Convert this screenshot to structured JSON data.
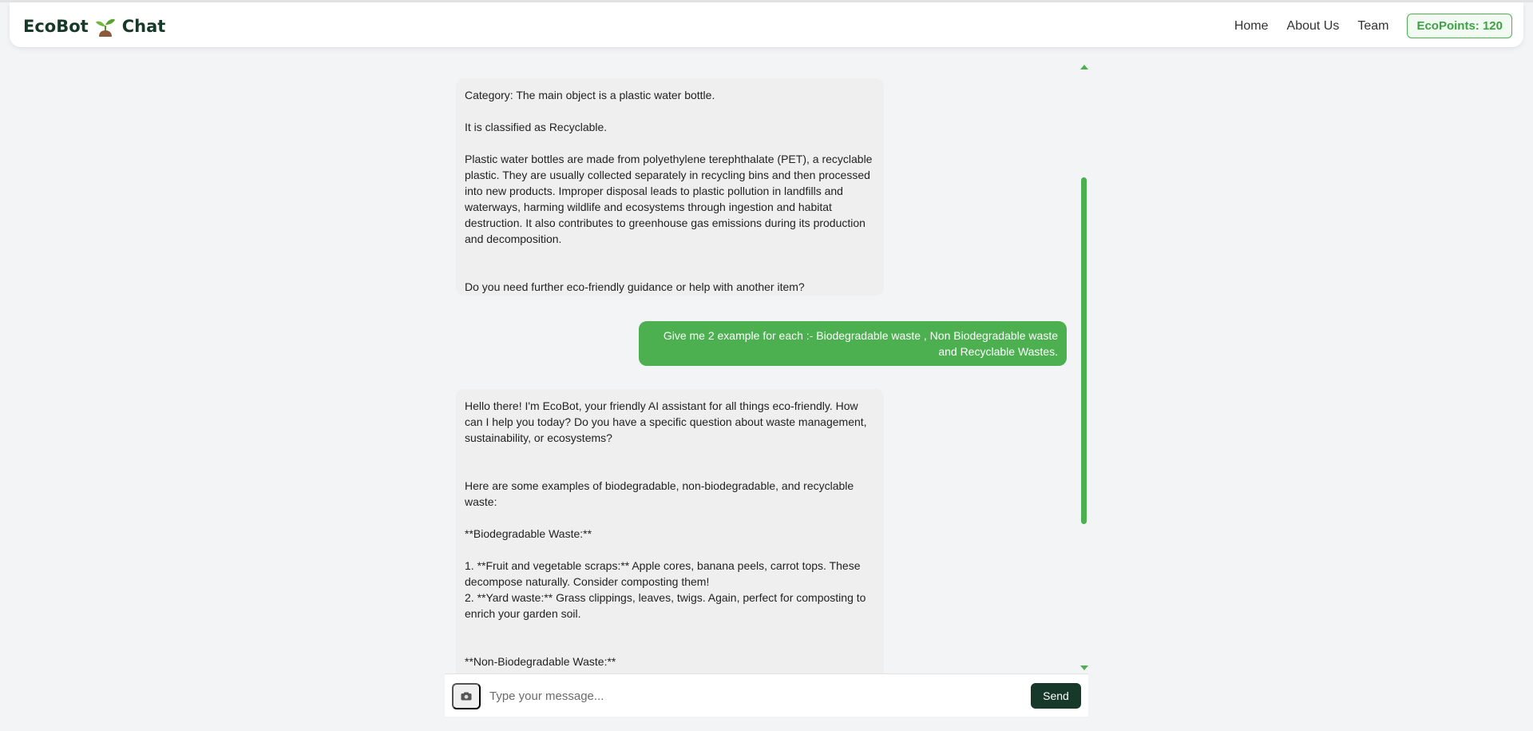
{
  "brand": {
    "left": "EcoBot",
    "right": "Chat",
    "icon": "sprout-icon"
  },
  "nav": {
    "home": "Home",
    "about": "About Us",
    "team": "Team",
    "ecopoints": "EcoPoints: 120"
  },
  "colors": {
    "accent": "#4caf50",
    "dark": "#16392a",
    "bubble": "#efefef"
  },
  "messages": [
    {
      "role": "bot",
      "text": "Category: The main object is a plastic water bottle.\n\nIt is classified as Recyclable.\n\nPlastic water bottles are made from polyethylene terephthalate (PET), a recyclable plastic. They are usually collected separately in recycling bins and then processed into new products. Improper disposal leads to plastic pollution in landfills and waterways, harming wildlife and ecosystems through ingestion and habitat destruction. It also contributes to greenhouse gas emissions during its production and decomposition.\n\n\nDo you need further eco-friendly guidance or help with another item?"
    },
    {
      "role": "user",
      "text": "Give me 2 example for each :- Biodegradable waste , Non Biodegradable waste and Recyclable Wastes."
    },
    {
      "role": "bot",
      "text": "Hello there! I'm EcoBot, your friendly AI assistant for all things eco-friendly. How can I help you today? Do you have a specific question about waste management, sustainability, or ecosystems?\n\n\nHere are some examples of biodegradable, non-biodegradable, and recyclable waste:\n\n**Biodegradable Waste:**\n\n1. **Fruit and vegetable scraps:** Apple cores, banana peels, carrot tops. These decompose naturally. Consider composting them!\n2. **Yard waste:** Grass clippings, leaves, twigs. Again, perfect for composting to enrich your garden soil.\n\n\n**Non-Biodegradable Waste:**"
    }
  ],
  "input": {
    "placeholder": "Type your message...",
    "value": "",
    "camera_icon": "camera-icon"
  },
  "send_label": "Send"
}
